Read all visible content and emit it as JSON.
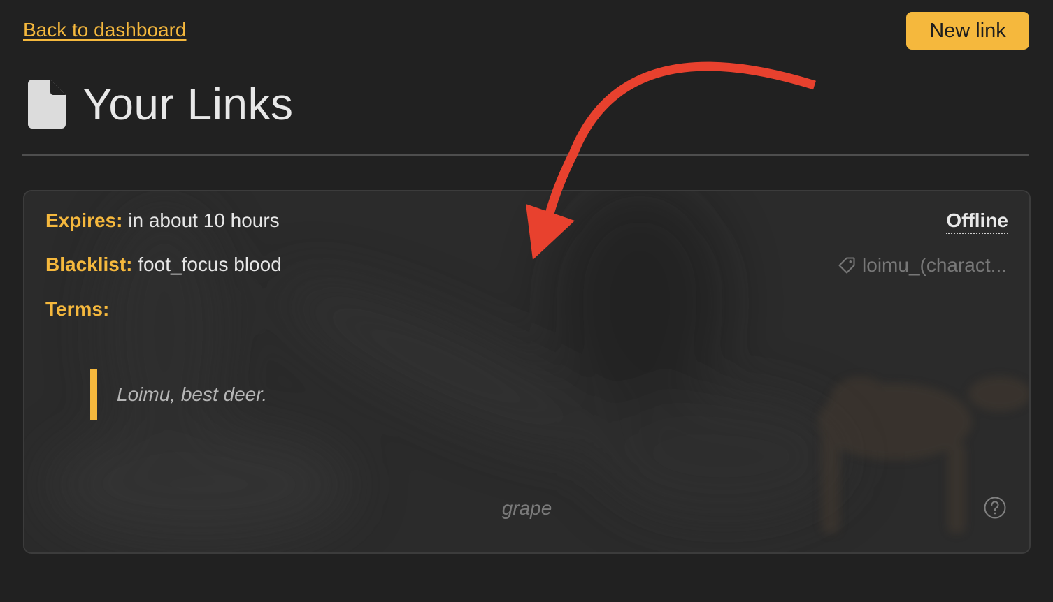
{
  "nav": {
    "back_label": "Back to dashboard",
    "new_link_label": "New link"
  },
  "header": {
    "title": "Your Links",
    "icon": "file-icon"
  },
  "link_card": {
    "expires": {
      "label": "Expires:",
      "value": "in about 10 hours"
    },
    "blacklist": {
      "label": "Blacklist:",
      "value": "foot_focus blood"
    },
    "terms": {
      "label": "Terms:"
    },
    "status": "Offline",
    "tag": {
      "icon": "tag-icon",
      "text": "loimu_(charact..."
    },
    "quote": "Loimu, best deer.",
    "footer_word": "grape",
    "help_icon": "help-circle-icon"
  },
  "annotation": {
    "icon": "red-arrow",
    "color": "#e8412e"
  },
  "colors": {
    "accent": "#f5b83d",
    "background": "#212121"
  }
}
